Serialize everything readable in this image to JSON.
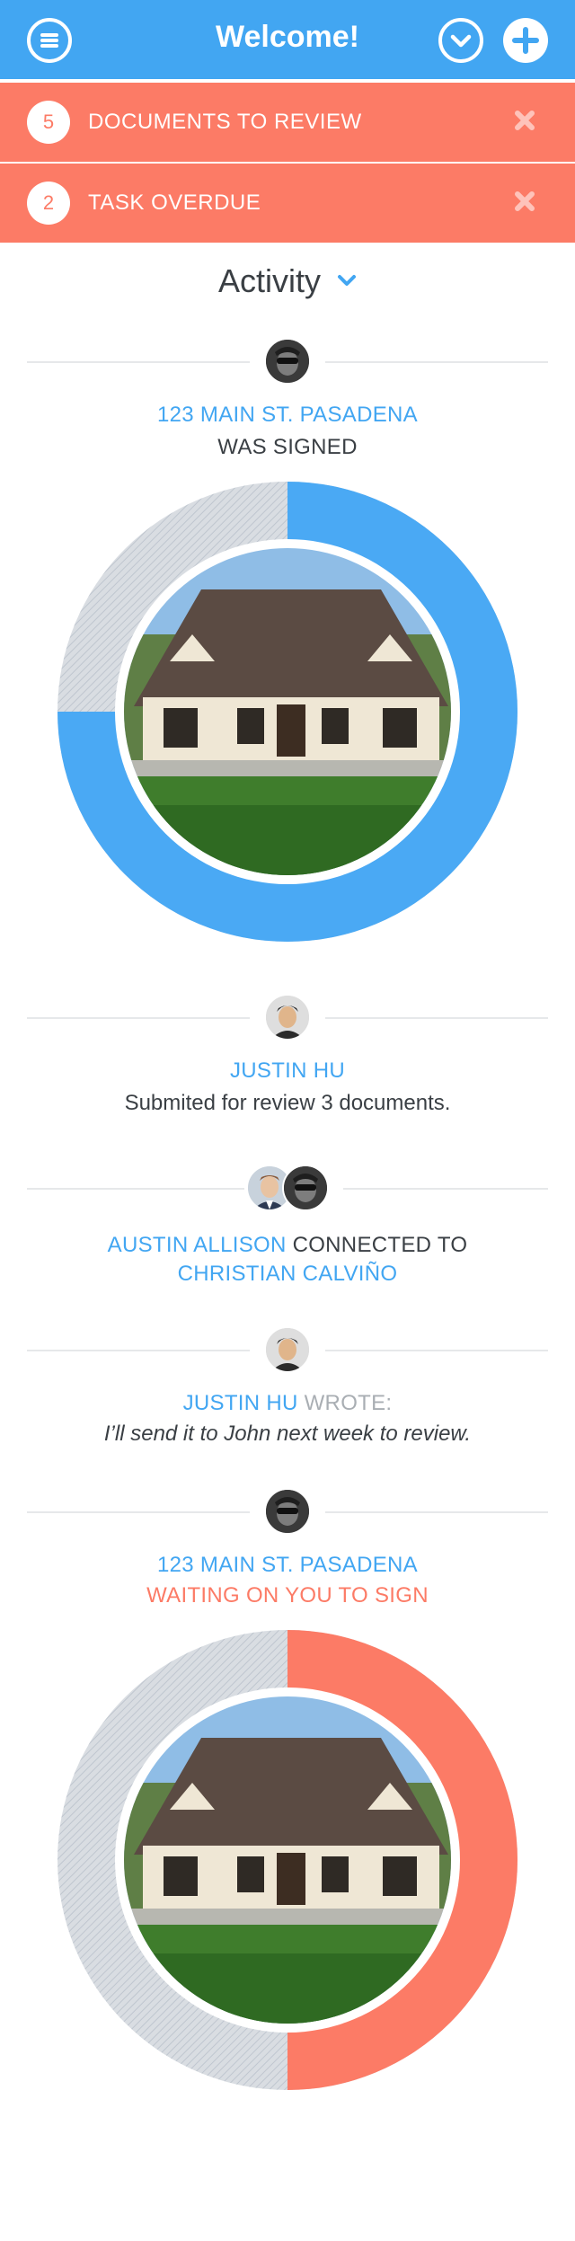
{
  "header": {
    "title": "Welcome!"
  },
  "notifications": [
    {
      "count": "5",
      "label": "DOCUMENTS TO REVIEW"
    },
    {
      "count": "2",
      "label": "TASK OVERDUE"
    }
  ],
  "activity": {
    "label": "Activity"
  },
  "feed": [
    {
      "address": "123 MAIN ST. PASADENA",
      "status": "WAS SIGNED",
      "progress": 0.75,
      "ring_color": "#4aa9f4"
    },
    {
      "name": "JUSTIN HU",
      "text": "Submited for review 3 documents."
    },
    {
      "from": "AUSTIN ALLISON",
      "verb": "CONNECTED TO",
      "to": "CHRISTIAN CALVIÑO"
    },
    {
      "name": "JUSTIN HU",
      "verb": "WROTE:",
      "message": "I’ll send it to John next week to review."
    },
    {
      "address": "123 MAIN ST. PASADENA",
      "status": "WAITING ON YOU TO SIGN",
      "progress": 0.5,
      "ring_color": "#fc7b66"
    }
  ],
  "colors": {
    "primary": "#42a6f2",
    "alert": "#fc7b66"
  }
}
